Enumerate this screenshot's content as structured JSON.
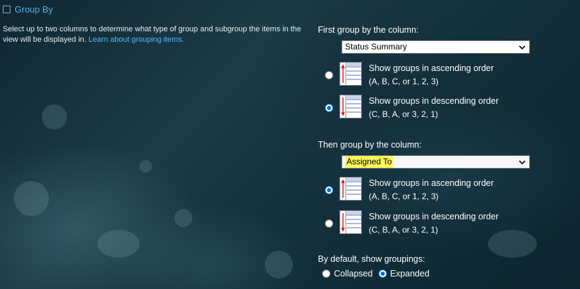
{
  "section": {
    "title": "Group By",
    "description": "Select up to two columns to determine what type of group and subgroup the items in the view will be displayed in.",
    "learn_link": "Learn about grouping items."
  },
  "first_group": {
    "label": "First group by the column:",
    "selected": "Status Summary",
    "options": [
      {
        "title": "Show groups in ascending order",
        "sub": "(A, B, C, or 1, 2, 3)",
        "checked": false
      },
      {
        "title": "Show groups in descending order",
        "sub": "(C, B, A, or 3, 2, 1)",
        "checked": true
      }
    ]
  },
  "second_group": {
    "label": "Then group by the column:",
    "selected": "Assigned To",
    "options": [
      {
        "title": "Show groups in ascending order",
        "sub": "(A, B, C, or 1, 2, 3)",
        "checked": true
      },
      {
        "title": "Show groups in descending order",
        "sub": "(C, B, A, or 3, 2, 1)",
        "checked": false
      }
    ]
  },
  "default_groupings": {
    "label": "By default, show groupings:",
    "collapsed_label": "Collapsed",
    "expanded_label": "Expanded",
    "selected": "Expanded"
  },
  "colors": {
    "link": "#5bb5f0",
    "radio_selected": "#0a6ed1",
    "highlight": "#fdf75a"
  }
}
